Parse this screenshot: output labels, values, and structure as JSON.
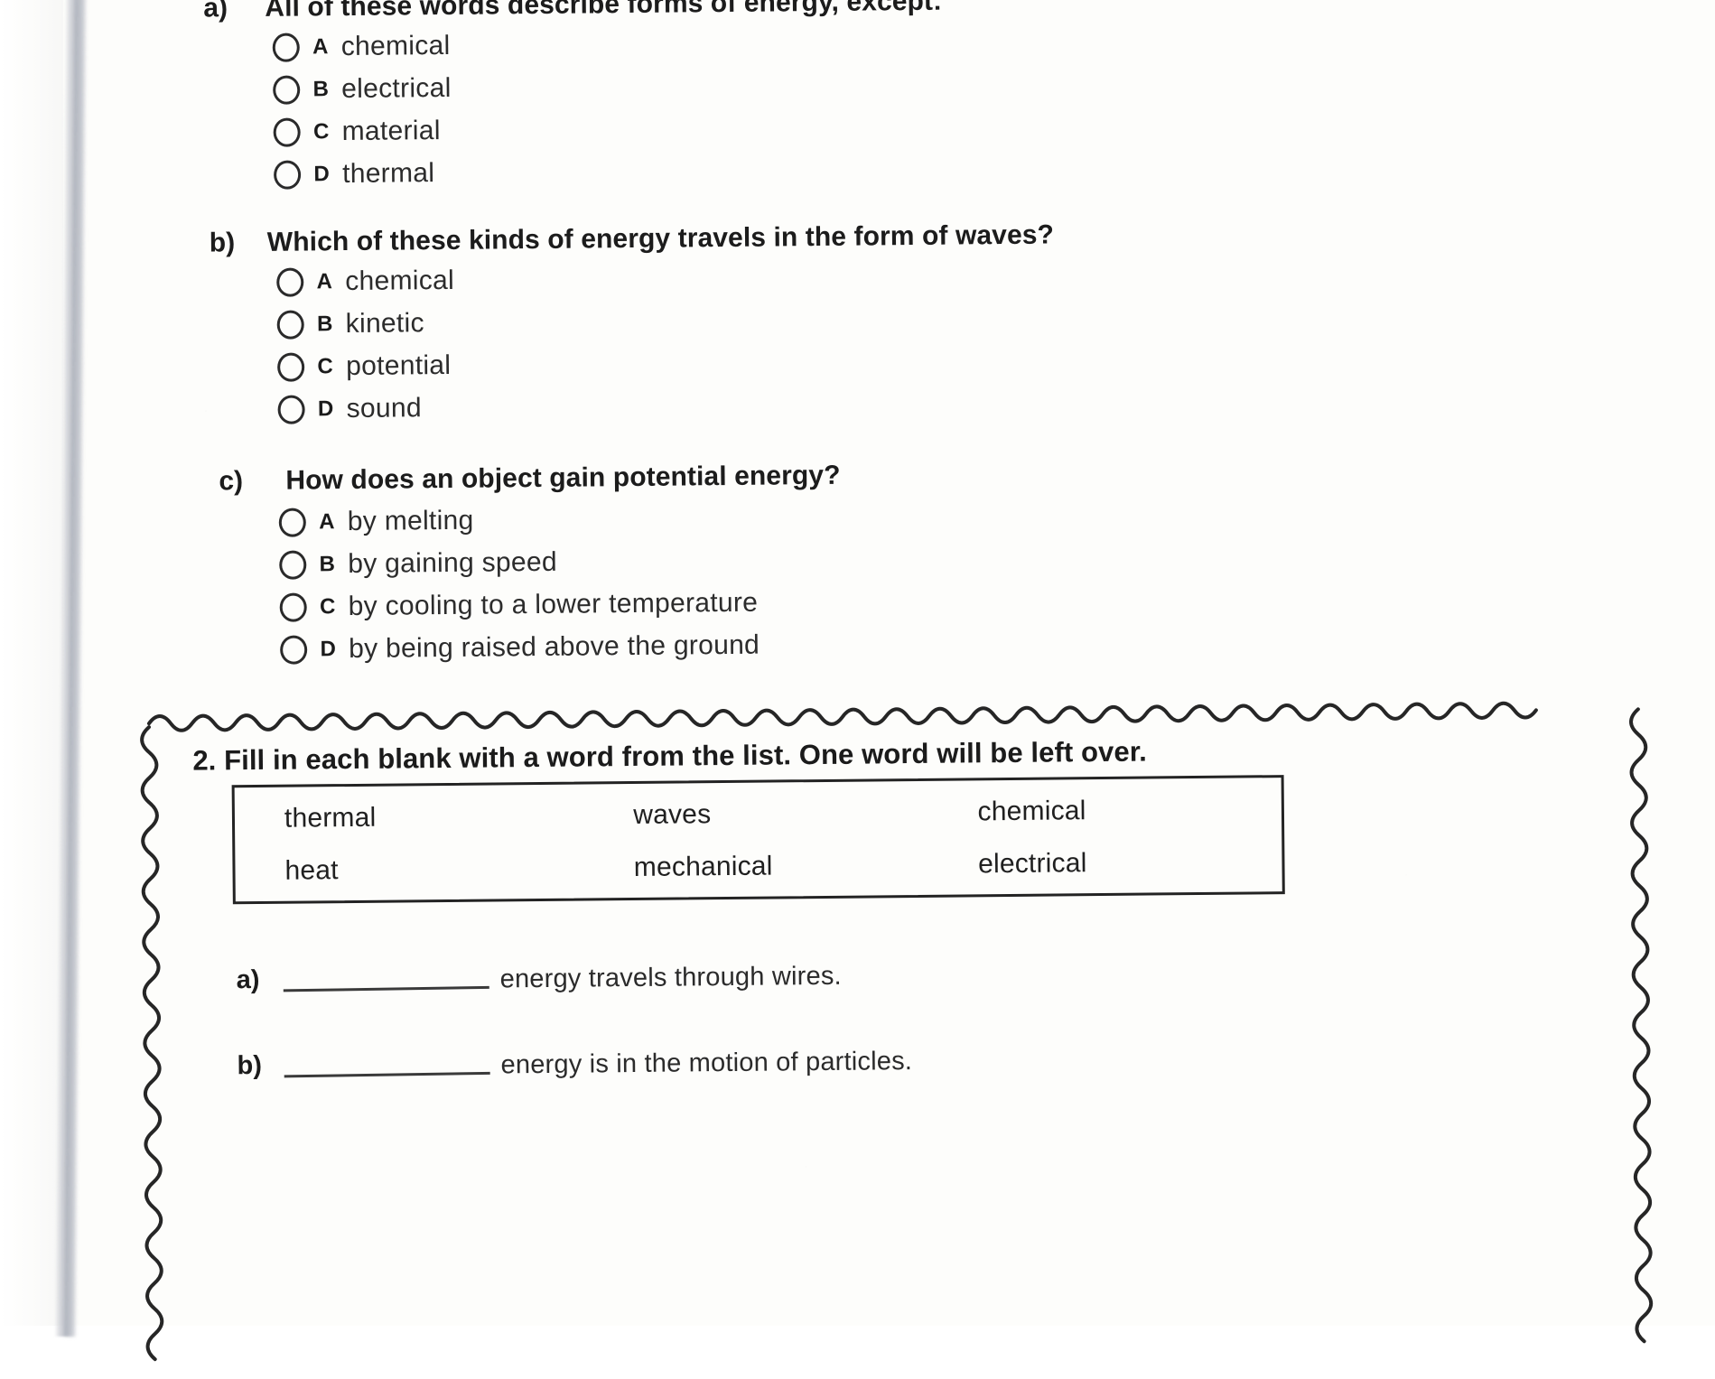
{
  "worksheet": {
    "questions": [
      {
        "letter": "a)",
        "stem": "All of these words describe forms of energy, except:",
        "options": [
          {
            "letter": "A",
            "text": "chemical"
          },
          {
            "letter": "B",
            "text": "electrical"
          },
          {
            "letter": "C",
            "text": "material"
          },
          {
            "letter": "D",
            "text": "thermal"
          }
        ]
      },
      {
        "letter": "b)",
        "stem": "Which of these kinds of energy travels in the form of waves?",
        "options": [
          {
            "letter": "A",
            "text": "chemical"
          },
          {
            "letter": "B",
            "text": "kinetic"
          },
          {
            "letter": "C",
            "text": "potential"
          },
          {
            "letter": "D",
            "text": "sound"
          }
        ]
      },
      {
        "letter": "c)",
        "stem": "How does an object gain potential energy?",
        "options": [
          {
            "letter": "A",
            "text": "by melting"
          },
          {
            "letter": "B",
            "text": "by gaining speed"
          },
          {
            "letter": "C",
            "text": "by cooling to a lower temperature"
          },
          {
            "letter": "D",
            "text": "by being raised above the ground"
          }
        ]
      }
    ],
    "question2": {
      "heading": "2.  Fill in each blank with a word from the list. One word will be left over.",
      "word_bank": {
        "row1": [
          "thermal",
          "waves",
          "chemical"
        ],
        "row2": [
          "heat",
          "mechanical",
          "electrical"
        ]
      },
      "blanks": [
        {
          "letter": "a)",
          "text": "energy travels through wires."
        },
        {
          "letter": "b)",
          "text": "energy is in the motion of particles."
        }
      ]
    }
  },
  "colors": {
    "ink": "#1c1c1c",
    "body_text": "#2c2c2c",
    "rule": "#232323",
    "paper": "#fdfdfb"
  }
}
